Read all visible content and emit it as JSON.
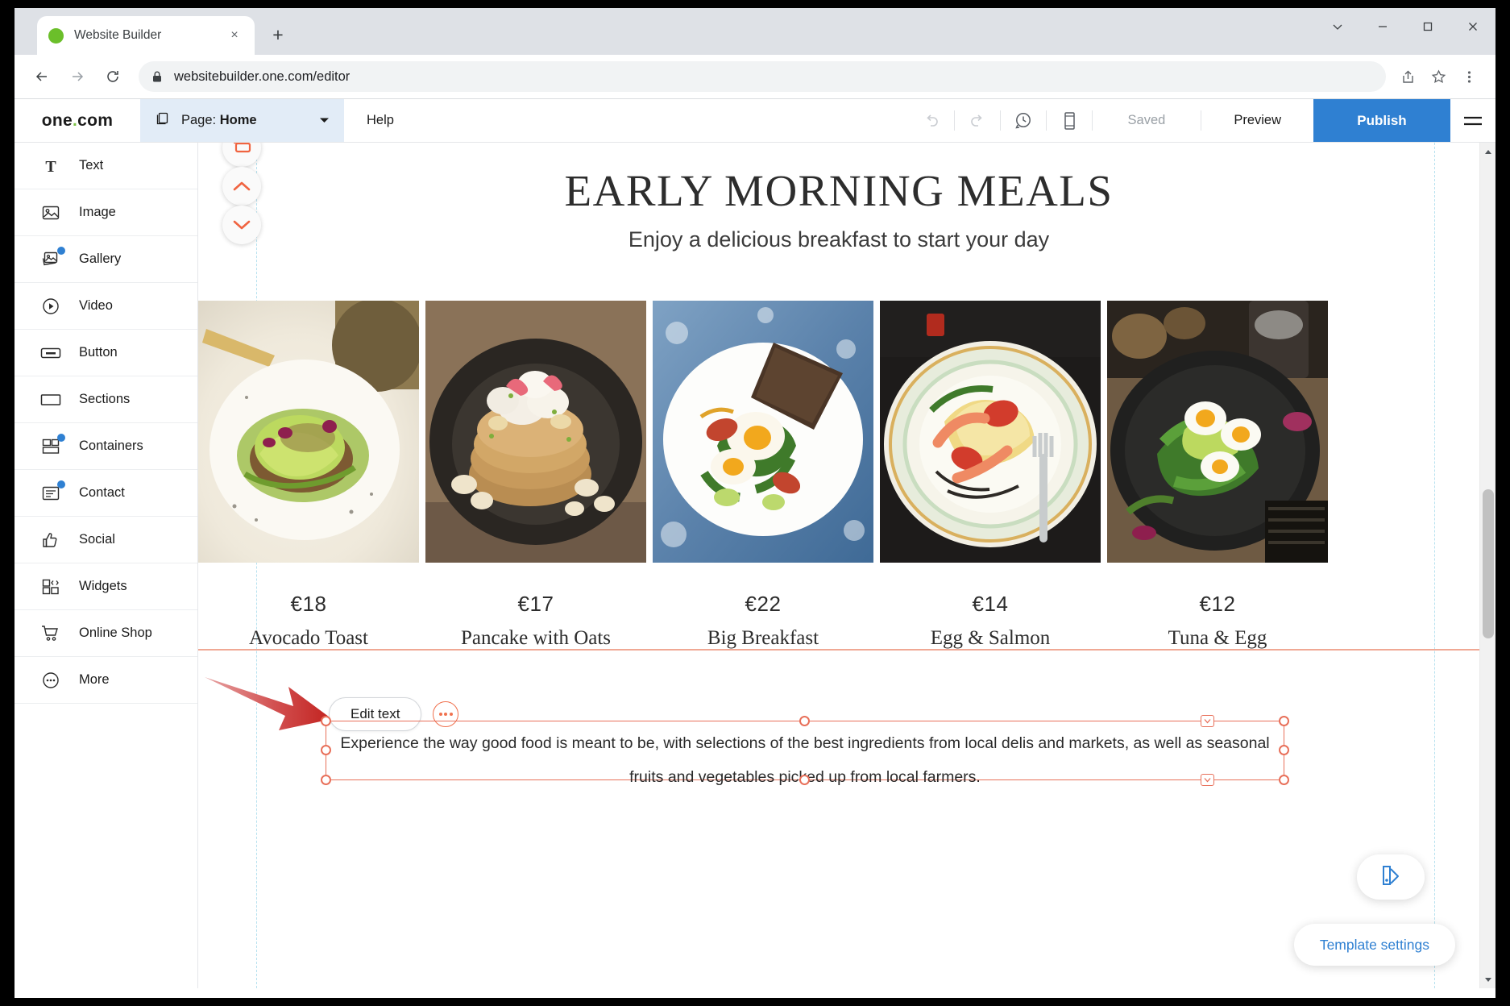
{
  "browser": {
    "tab": {
      "title": "Website Builder",
      "favicon": "green-circle-favicon",
      "close": "×"
    },
    "new_tab": "+",
    "window_controls": [
      "chevron-down",
      "minimize",
      "maximize",
      "close"
    ],
    "nav": {
      "back": "back-arrow",
      "forward": "forward-arrow",
      "reload": "reload-arrow"
    },
    "address": {
      "url": "websitebuilder.one.com/editor",
      "lock": "lock-icon"
    },
    "toolbar_icons": [
      "share-icon",
      "bookmark-star-icon",
      "more-vert-icon"
    ]
  },
  "appbar": {
    "brand": "one",
    "brand_tld": ".com",
    "brand_dot": ".",
    "page_label": "Page: ",
    "page_value": "Home",
    "help": "Help",
    "undo": "undo-icon",
    "redo": "redo-icon",
    "history": "history-clock-icon",
    "mobile": "mobile-preview-icon",
    "saved": "Saved",
    "preview": "Preview",
    "publish": "Publish",
    "menu": "hamburger-menu-icon",
    "publish_color": "#2f80d2",
    "page_pill_color": "#e2ecf7"
  },
  "sidebar": {
    "items": [
      {
        "label": "Text",
        "icon": "text-icon",
        "badge": false
      },
      {
        "label": "Image",
        "icon": "image-icon",
        "badge": false
      },
      {
        "label": "Gallery",
        "icon": "gallery-icon",
        "badge": true
      },
      {
        "label": "Video",
        "icon": "video-icon",
        "badge": false
      },
      {
        "label": "Button",
        "icon": "button-icon",
        "badge": false
      },
      {
        "label": "Sections",
        "icon": "sections-icon",
        "badge": false
      },
      {
        "label": "Containers",
        "icon": "containers-icon",
        "badge": true
      },
      {
        "label": "Contact",
        "icon": "contact-icon",
        "badge": true
      },
      {
        "label": "Social",
        "icon": "thumbs-up-icon",
        "badge": false
      },
      {
        "label": "Widgets",
        "icon": "widgets-icon",
        "badge": false
      },
      {
        "label": "Online Shop",
        "icon": "cart-icon",
        "badge": false
      },
      {
        "label": "More",
        "icon": "more-dots-icon",
        "badge": false
      }
    ],
    "badge_color": "#2f80d2"
  },
  "canvas": {
    "site_title": "EARLY MORNING MEALS",
    "site_subtitle": "Enjoy a delicious breakfast to start your day",
    "meals": [
      {
        "price": "€18",
        "name": "Avocado Toast"
      },
      {
        "price": "€17",
        "name": "Pancake with Oats"
      },
      {
        "price": "€22",
        "name": "Big Breakfast"
      },
      {
        "price": "€14",
        "name": "Egg & Salmon"
      },
      {
        "price": "€12",
        "name": "Tuna & Egg"
      }
    ],
    "section_handles": [
      "section-icon",
      "move-up-chevron",
      "move-down-chevron"
    ],
    "handle_color": "#f06441",
    "edit_text_button": "Edit text",
    "more_options_button": "more-options-icon",
    "selected_text": "Experience the way good food is meant to be, with selections of the best ingredients from local delis and markets, as well as seasonal fruits and vegetables picked up from local farmers.",
    "selection_color": "#e8705a",
    "divider_color": "#f0a894",
    "guide_color": "#b7e1ef"
  },
  "floating": {
    "palette_icon": "color-palette-icon",
    "template_settings": "Template settings",
    "accent_color": "#2f80d2"
  },
  "annotation": {
    "arrow": "red-pointer-arrow",
    "arrow_color": "#cc2229"
  }
}
